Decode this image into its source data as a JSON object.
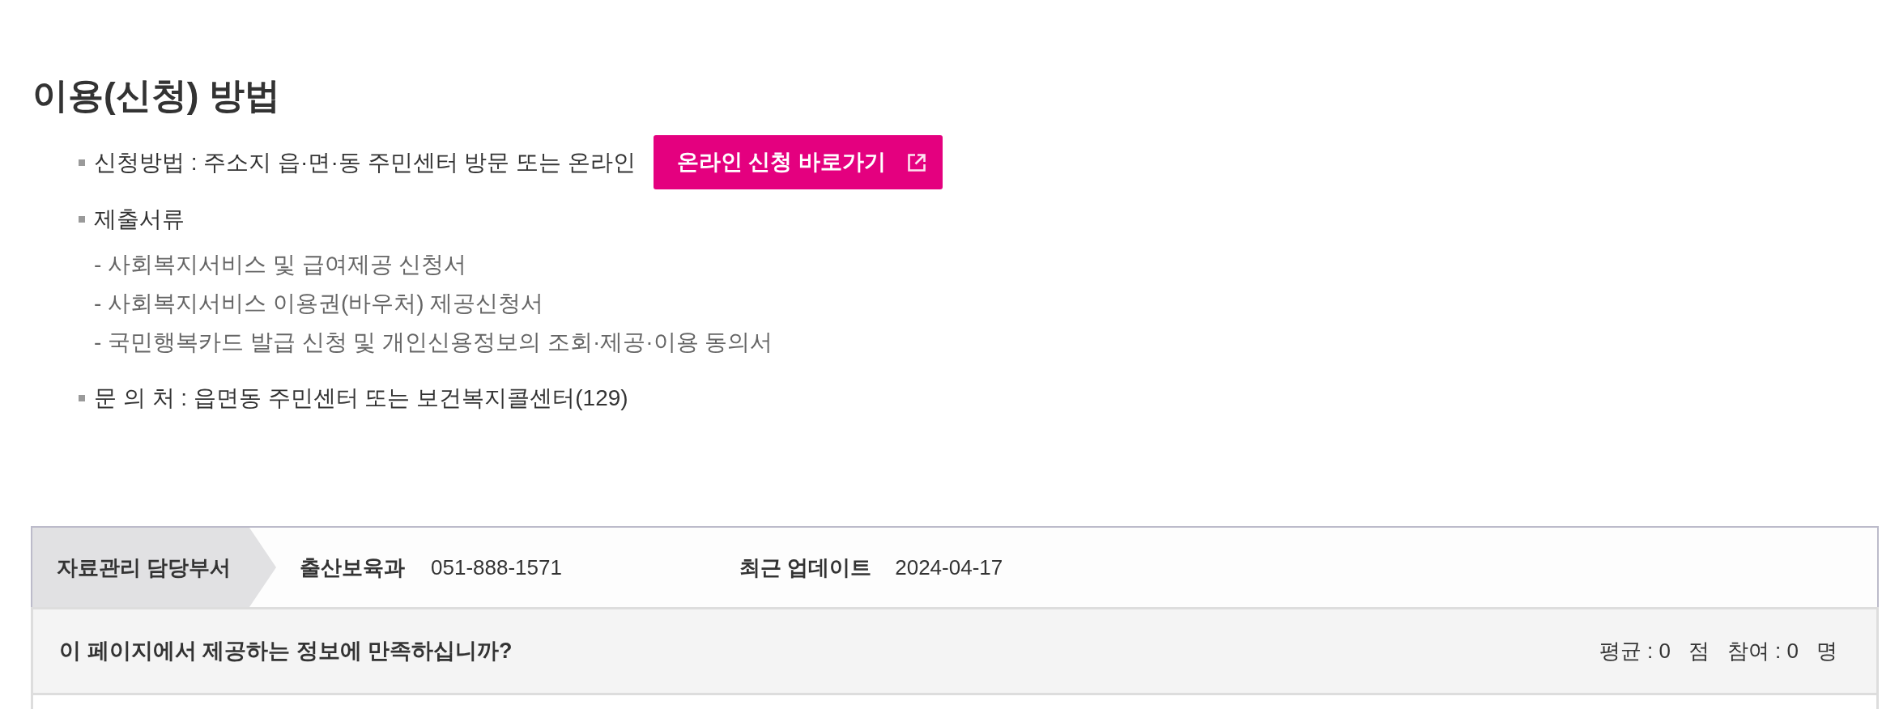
{
  "section": {
    "title": "이용(신청) 방법",
    "items": [
      {
        "text": "신청방법 : 주소지 읍·면·동 주민센터 방문 또는 온라인",
        "button": {
          "label": "온라인 신청 바로가기"
        }
      },
      {
        "text": "제출서류",
        "children": [
          {
            "text": "- 사회복지서비스 및 급여제공 신청서"
          },
          {
            "text": "- 사회복지서비스 이용권(바우처) 제공신청서"
          },
          {
            "text": "- 국민행복카드 발급 신청 및 개인신용정보의 조회·제공·이용 동의서"
          }
        ]
      },
      {
        "text": "문 의 처 : 읍면동 주민센터 또는 보건복지콜센터(129)"
      }
    ]
  },
  "info_bar": {
    "label": "자료관리 담당부서",
    "department": "출산보육과",
    "phone": "051-888-1571",
    "updated_label": "최근 업데이트",
    "updated_date": "2024-04-17"
  },
  "survey": {
    "question": "이 페이지에서 제공하는 정보에 만족하십니까?",
    "stats": [
      {
        "label": "평균 : 0",
        "unit": "점"
      },
      {
        "label": "참여 : 0",
        "unit": "명"
      }
    ]
  }
}
